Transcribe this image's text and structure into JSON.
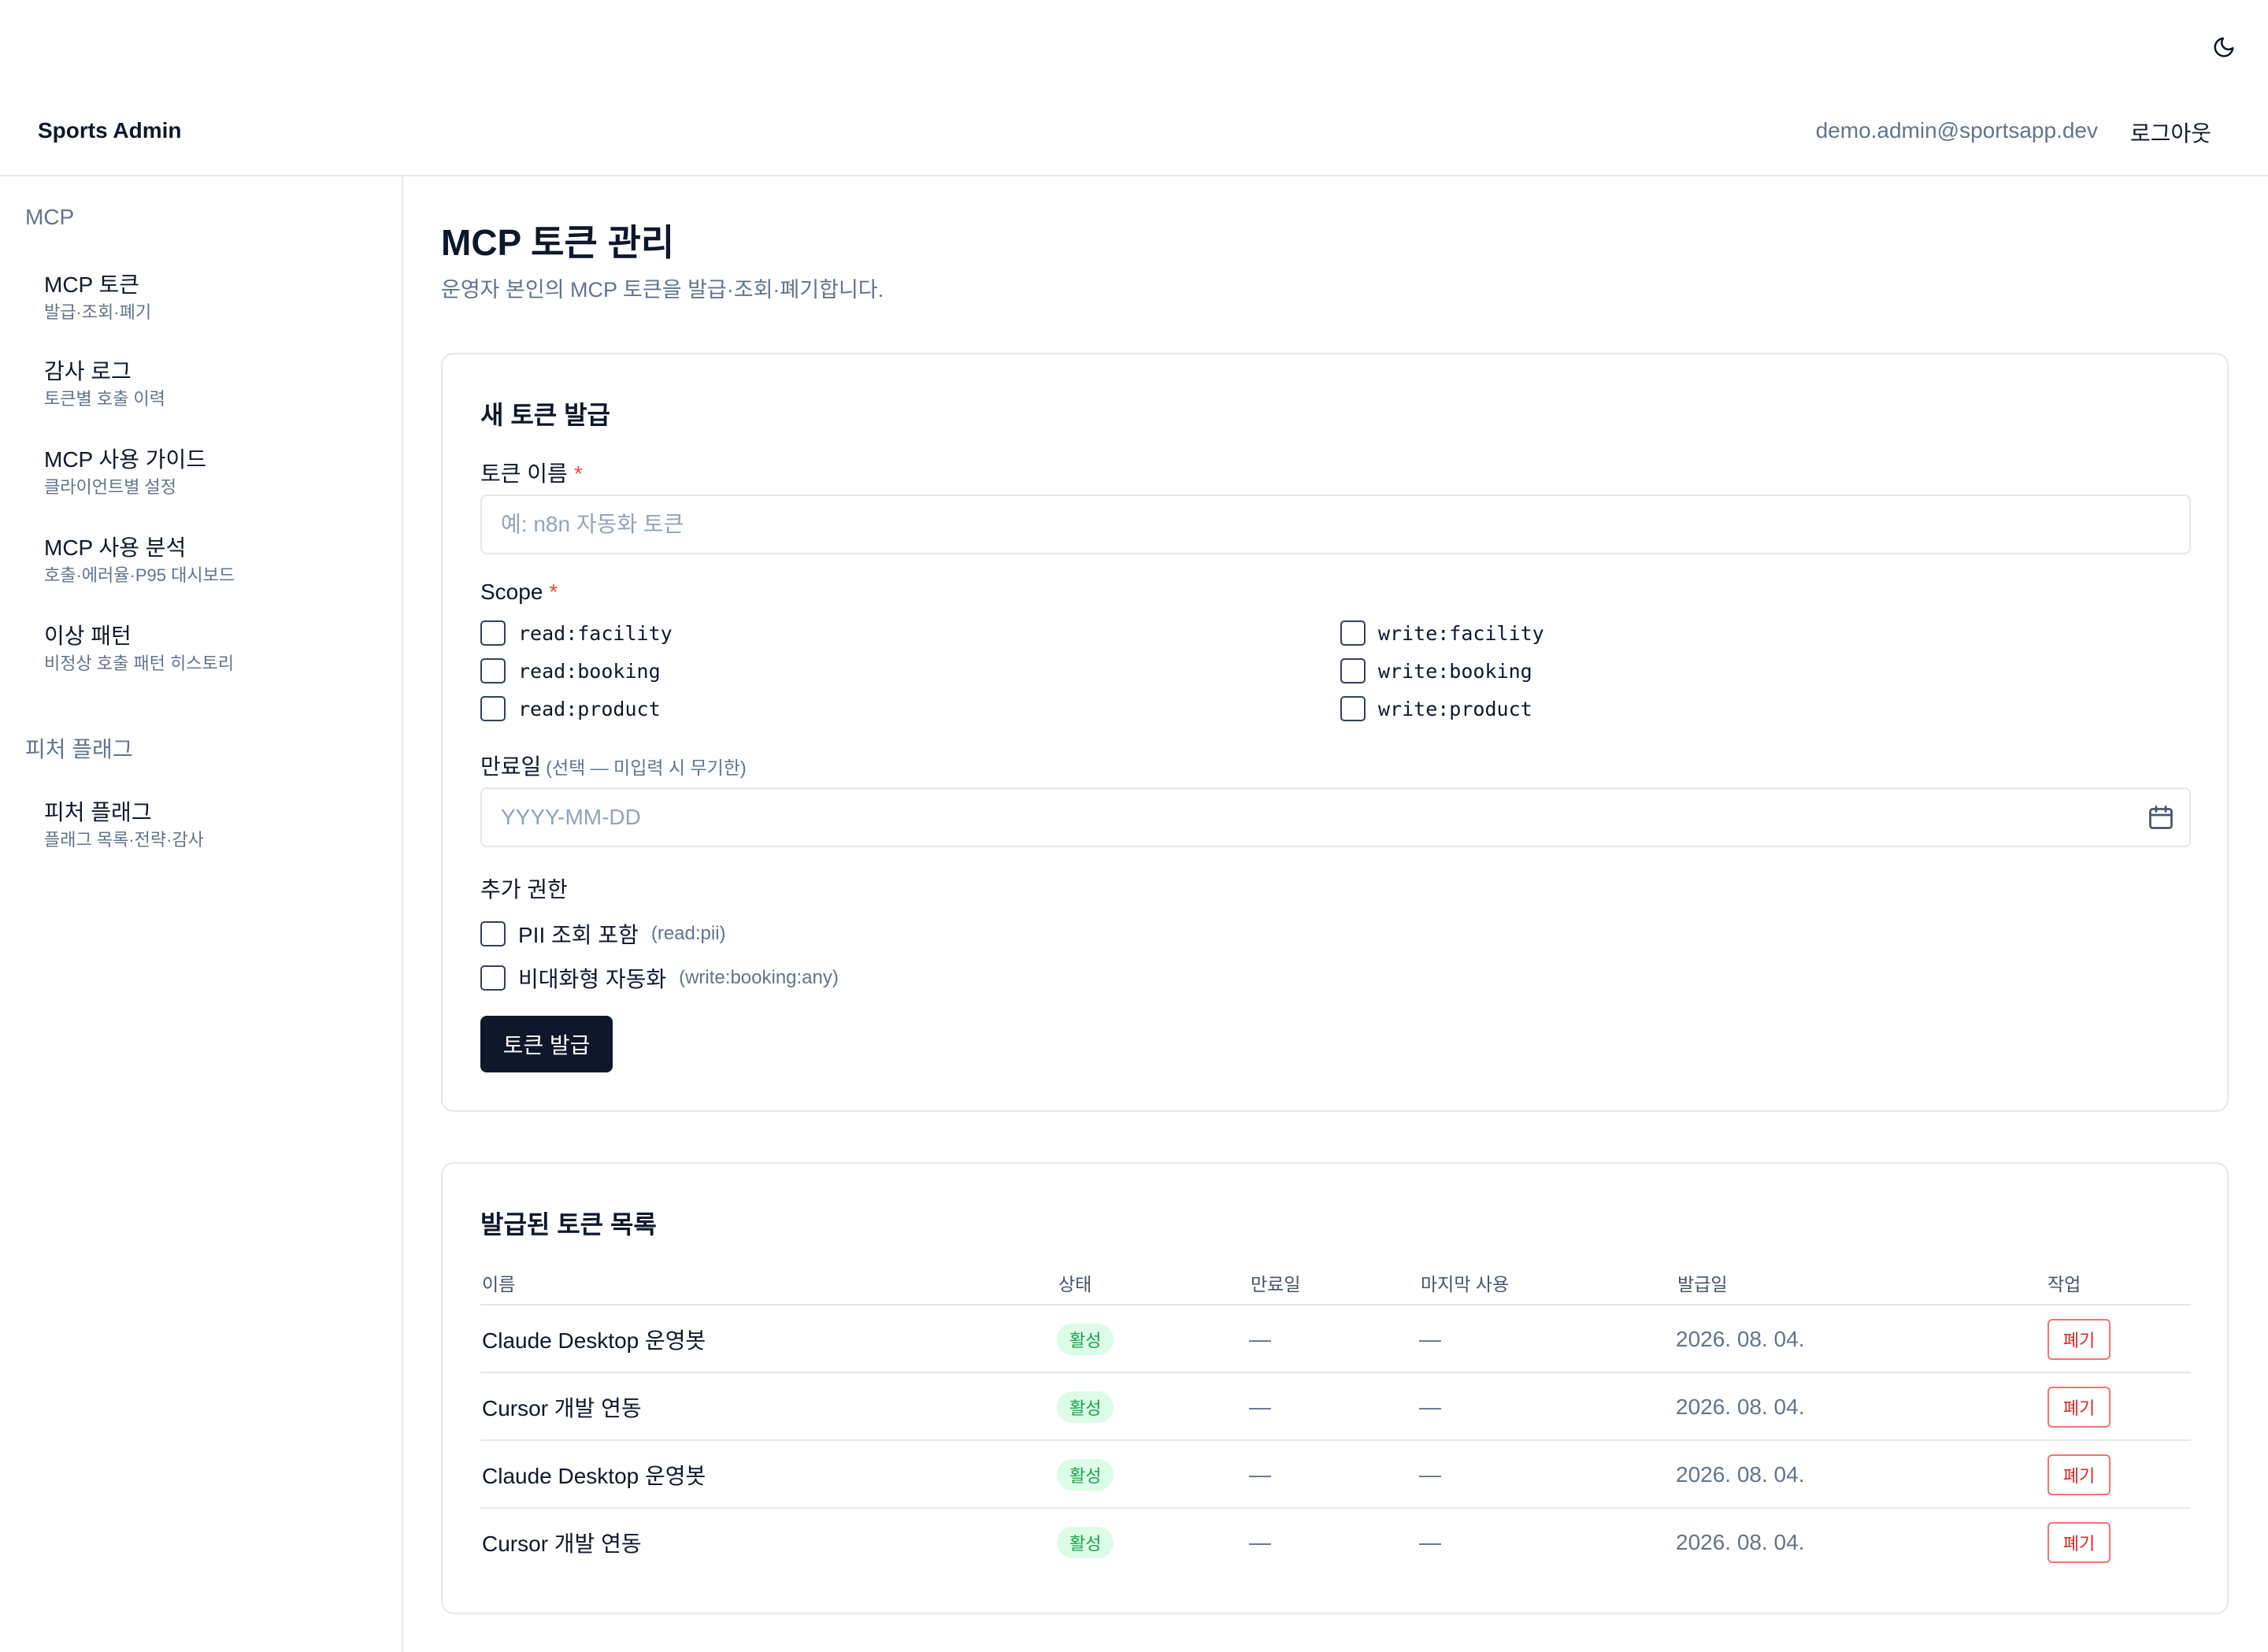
{
  "header": {
    "brand": "Sports Admin",
    "user_email": "demo.admin@sportsapp.dev",
    "logout_label": "로그아웃",
    "theme_icon": "moon-icon"
  },
  "sidebar": {
    "sections": [
      {
        "title": "MCP",
        "items": [
          {
            "label": "MCP 토큰",
            "sub": "발급·조회·폐기"
          },
          {
            "label": "감사 로그",
            "sub": "토큰별 호출 이력"
          },
          {
            "label": "MCP 사용 가이드",
            "sub": "클라이언트별 설정"
          },
          {
            "label": "MCP 사용 분석",
            "sub": "호출·에러율·P95 대시보드"
          },
          {
            "label": "이상 패턴",
            "sub": "비정상 호출 패턴 히스토리"
          }
        ]
      },
      {
        "title": "피처 플래그",
        "items": [
          {
            "label": "피처 플래그",
            "sub": "플래그 목록·전략·감사"
          }
        ]
      }
    ]
  },
  "page": {
    "title": "MCP 토큰 관리",
    "subtitle": "운영자 본인의 MCP 토큰을 발급·조회·폐기합니다."
  },
  "form": {
    "title": "새 토큰 발급",
    "name_label": "토큰 이름",
    "required_mark": "*",
    "name_placeholder": "예: n8n 자동화 토큰",
    "scope_label": "Scope",
    "scopes_left": [
      "read:facility",
      "read:booking",
      "read:product"
    ],
    "scopes_right": [
      "write:facility",
      "write:booking",
      "write:product"
    ],
    "expiry_label": "만료일",
    "expiry_hint": "(선택 — 미입력 시 무기한)",
    "expiry_placeholder": "YYYY-MM-DD",
    "extra_label": "추가 권한",
    "extra_pii_label": "PII 조회 포함",
    "extra_pii_note": "(read:pii)",
    "extra_auto_label": "비대화형 자동화",
    "extra_auto_note": "(write:booking:any)",
    "submit_label": "토큰 발급"
  },
  "tokens": {
    "title": "발급된 토큰 목록",
    "columns": [
      "이름",
      "상태",
      "만료일",
      "마지막 사용",
      "발급일",
      "작업"
    ],
    "rows": [
      {
        "name": "Claude Desktop 운영봇",
        "status": "활성",
        "expires": "—",
        "last_used": "—",
        "issued": "2026. 08. 04.",
        "action": "폐기"
      },
      {
        "name": "Cursor 개발 연동",
        "status": "활성",
        "expires": "—",
        "last_used": "—",
        "issued": "2026. 08. 04.",
        "action": "폐기"
      },
      {
        "name": "Claude Desktop 운영봇",
        "status": "활성",
        "expires": "—",
        "last_used": "—",
        "issued": "2026. 08. 04.",
        "action": "폐기"
      },
      {
        "name": "Cursor 개발 연동",
        "status": "활성",
        "expires": "—",
        "last_used": "—",
        "issued": "2026. 08. 04.",
        "action": "폐기"
      }
    ]
  },
  "colors": {
    "primary": "#0f172a",
    "muted": "#64748b",
    "border": "#e5e7eb",
    "required": "#ef4444",
    "badge_bg": "#dcfce7",
    "badge_text": "#16a34a",
    "danger": "#dc2626"
  }
}
